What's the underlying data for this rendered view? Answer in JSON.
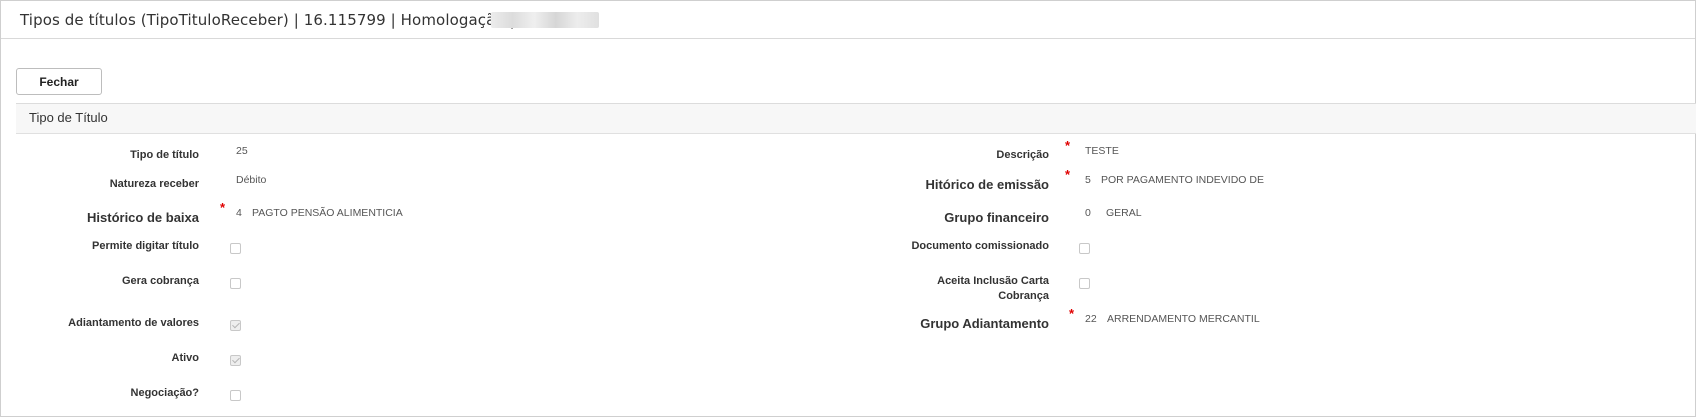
{
  "window": {
    "title": "Tipos de títulos (TipoTituloReceber) | 16.115799 | Homologação |"
  },
  "toolbar": {
    "close_label": "Fechar"
  },
  "panel": {
    "title": "Tipo de Título"
  },
  "form": {
    "tipo_titulo": {
      "label": "Tipo de título",
      "value": "25"
    },
    "natureza_receber": {
      "label": "Natureza receber",
      "value": "Débito"
    },
    "historico_baixa": {
      "label": "Histórico de baixa",
      "code": "4",
      "description": "PAGTO PENSÃO ALIMENTICIA",
      "required": "*"
    },
    "permite_digitar": {
      "label": "Permite digitar título",
      "checked": false
    },
    "gera_cobranca": {
      "label": "Gera cobrança",
      "checked": false
    },
    "adiantamento_valores": {
      "label": "Adiantamento de valores",
      "checked": true
    },
    "ativo": {
      "label": "Ativo",
      "checked": true
    },
    "negociacao": {
      "label": "Negociação?",
      "checked": false
    },
    "descricao": {
      "label": "Descrição",
      "value": "TESTE",
      "required": "*"
    },
    "historico_emissao": {
      "label": "Hitórico de emissão",
      "code": "5",
      "description": "POR PAGAMENTO INDEVIDO DE",
      "required": "*"
    },
    "grupo_financeiro": {
      "label": "Grupo financeiro",
      "code": "0",
      "description": "GERAL"
    },
    "documento_comissionado": {
      "label": "Documento comissionado",
      "checked": false
    },
    "aceita_inclusao_line1": "Aceita Inclusão Carta",
    "aceita_inclusao_line2": "Cobrança",
    "aceita_inclusao_checked": false,
    "grupo_adiantamento": {
      "label": "Grupo Adiantamento",
      "code": "22",
      "description": "ARRENDAMENTO MERCANTIL",
      "required": "*"
    }
  }
}
